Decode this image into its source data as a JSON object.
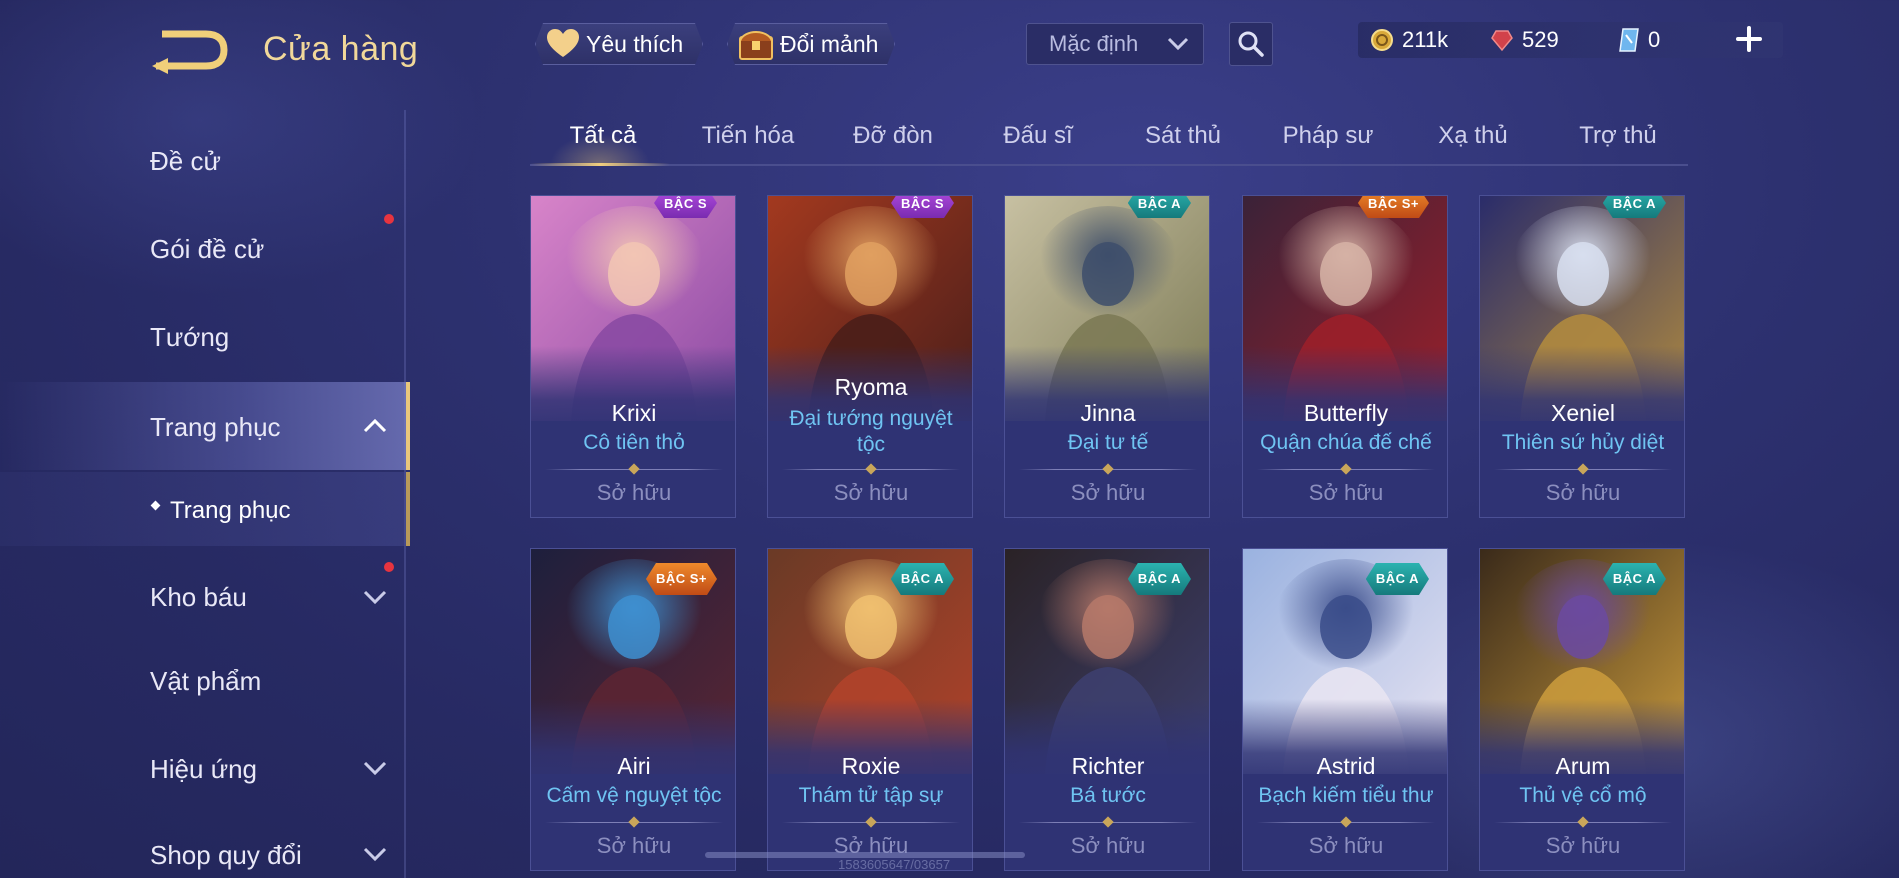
{
  "header": {
    "title": "Cửa hàng",
    "favorites_label": "Yêu thích",
    "exchange_label": "Đổi mảnh",
    "sort_value": "Mặc định"
  },
  "currency": {
    "gold": "211k",
    "ruby": "529",
    "coupon": "0"
  },
  "sidebar": {
    "items": [
      {
        "label": "Đề cử"
      },
      {
        "label": "Gói đề cử"
      },
      {
        "label": "Tướng"
      },
      {
        "label": "Trang phục"
      },
      {
        "label": "Kho báu"
      },
      {
        "label": "Vật phẩm"
      },
      {
        "label": "Hiệu ứng"
      },
      {
        "label": "Shop quy đổi"
      }
    ],
    "sub_item": "Trang phục"
  },
  "tabs": [
    "Tất cả",
    "Tiến hóa",
    "Đỡ đòn",
    "Đấu sĩ",
    "Sát thủ",
    "Pháp sư",
    "Xạ thủ",
    "Trợ thủ"
  ],
  "cards": [
    {
      "hero": "Krixi",
      "skin": "Cô tiên thỏ",
      "status": "Sở hữu",
      "tier": "BẬC S",
      "tier_class": "s",
      "colors": [
        "#d884c9",
        "#8a4aa3",
        "#f2c6b4"
      ]
    },
    {
      "hero": "Ryoma",
      "skin": "Đại tướng nguyệt tộc",
      "status": "Sở hữu",
      "tier": "BẬC S",
      "tier_class": "s",
      "colors": [
        "#a3391f",
        "#4a1e1a",
        "#e0a060"
      ]
    },
    {
      "hero": "Jinna",
      "skin": "Đại tư tế",
      "status": "Sở hữu",
      "tier": "BẬC A",
      "tier_class": "a",
      "colors": [
        "#c7c0a2",
        "#7c7a55",
        "#3d4d6b"
      ]
    },
    {
      "hero": "Butterfly",
      "skin": "Quận chúa đế chế",
      "status": "Sở hữu",
      "tier": "BẬC S+",
      "tier_class": "sp",
      "colors": [
        "#3a2238",
        "#9b1f2a",
        "#d6b3a6"
      ]
    },
    {
      "hero": "Xeniel",
      "skin": "Thiên sứ hủy diệt",
      "status": "Sở hữu",
      "tier": "BẬC A",
      "tier_class": "a",
      "colors": [
        "#2a2c6a",
        "#b08a3f",
        "#d8dff0"
      ]
    },
    {
      "hero": "Airi",
      "skin": "Cấm vệ nguyệt tộc",
      "status": "Sở hữu",
      "tier": "BẬC S+",
      "tier_class": "sp",
      "colors": [
        "#1d1f3d",
        "#5b2533",
        "#3e8fd0"
      ]
    },
    {
      "hero": "Roxie",
      "skin": "Thám tử tập sự",
      "status": "Sở hữu",
      "tier": "BẬC A",
      "tier_class": "a",
      "colors": [
        "#6a3a26",
        "#b0422a",
        "#f0c070"
      ]
    },
    {
      "hero": "Richter",
      "skin": "Bá tước",
      "status": "Sở hữu",
      "tier": "BẬC A",
      "tier_class": "a",
      "colors": [
        "#2a2226",
        "#3d3f6e",
        "#b6796a"
      ]
    },
    {
      "hero": "Astrid",
      "skin": "Bạch kiếm tiểu thư",
      "status": "Sở hữu",
      "tier": "BẬC A",
      "tier_class": "a",
      "colors": [
        "#9ab2e0",
        "#e8e4f2",
        "#3a4c8a"
      ]
    },
    {
      "hero": "Arum",
      "skin": "Thủ vệ cổ mộ",
      "status": "Sở hữu",
      "tier": "BẬC A",
      "tier_class": "a",
      "colors": [
        "#3a2a1a",
        "#c99a3c",
        "#6b4aa0"
      ]
    }
  ],
  "watermark": "1583605647/03657"
}
